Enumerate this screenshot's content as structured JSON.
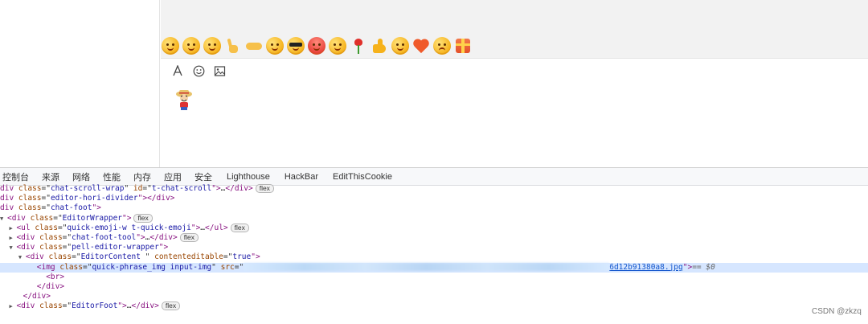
{
  "emoji_bar": {
    "items": [
      {
        "name": "tongue-out-face"
      },
      {
        "name": "thinking-face"
      },
      {
        "name": "shy-face"
      },
      {
        "name": "victory-hand"
      },
      {
        "name": "handshake"
      },
      {
        "name": "curious-face"
      },
      {
        "name": "sunglasses-face"
      },
      {
        "name": "red-faced-face"
      },
      {
        "name": "smiling-face"
      },
      {
        "name": "rose"
      },
      {
        "name": "thumbs-up"
      },
      {
        "name": "party-face"
      },
      {
        "name": "heart"
      },
      {
        "name": "crying-face"
      },
      {
        "name": "gift"
      }
    ]
  },
  "toolbar": {
    "font_icon": "A",
    "emoji_tool": "emoji-icon",
    "image_tool": "image-icon"
  },
  "devtools": {
    "tabs": [
      "控制台",
      "来源",
      "网络",
      "性能",
      "内存",
      "应用",
      "安全",
      "Lighthouse",
      "HackBar",
      "EditThisCookie"
    ],
    "dom_lines": {
      "l1_tag": "div",
      "l1_attr1": "class",
      "l1_val1": "chat-scroll-wrap",
      "l1_attr2": "id",
      "l1_val2": "t-chat-scroll",
      "l1_close": "</div>",
      "l2_val": "editor-hori-divider",
      "l3_val": "chat-foot",
      "l4_val": "EditorWrapper",
      "l5_val": "quick-emoji-w t-quick-emoji",
      "l6_val": "chat-foot-tool",
      "l7_val": "pell-editor-wrapper",
      "l8_val": "EditorContent ",
      "l8_attr2": "contenteditable",
      "l8_val2": "true",
      "l9_class": "quick-phrase_img input-img",
      "l9_src_tail": "6d12b91380a8.jpg",
      "l9_eq": "== $0",
      "l10": "<br>",
      "l11": "</div>",
      "l12": "</div>",
      "l13_val": "EditorFoot",
      "badge": "flex",
      "ellipsis": "…"
    }
  },
  "watermark": "CSDN @zkzq"
}
